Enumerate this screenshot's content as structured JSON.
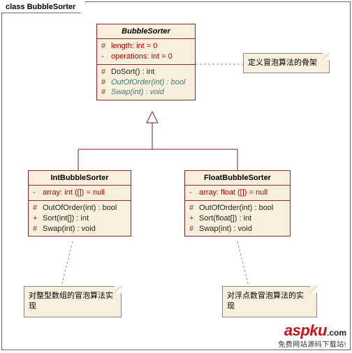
{
  "frame": {
    "title": "class BubbleSorter"
  },
  "classes": {
    "bubbleSorter": {
      "name": "BubbleSorter",
      "attrs": [
        {
          "vis": "#",
          "text": "length:  int = 0",
          "style": "red"
        },
        {
          "vis": "-",
          "text": "operations:  int = 0",
          "style": "red"
        }
      ],
      "ops": [
        {
          "vis": "#",
          "text": "DoSort() : int",
          "style": "nrm"
        },
        {
          "vis": "#",
          "text": "OutOfOrder(int) : bool",
          "style": "teal"
        },
        {
          "vis": "#",
          "text": "Swap(int) : void",
          "style": "teal"
        }
      ]
    },
    "intBubbleSorter": {
      "name": "IntBubbleSorter",
      "attrs": [
        {
          "vis": "-",
          "text": "array:  int ([]) = null",
          "style": "red"
        }
      ],
      "ops": [
        {
          "vis": "#",
          "text": "OutOfOrder(int) : bool",
          "style": "nrm"
        },
        {
          "vis": "+",
          "text": "Sort(int[]) : int",
          "style": "nrm"
        },
        {
          "vis": "#",
          "text": "Swap(int) : void",
          "style": "nrm"
        }
      ]
    },
    "floatBubbleSorter": {
      "name": "FloatBubbleSorter",
      "attrs": [
        {
          "vis": "-",
          "text": "array:  float ([]) = null",
          "style": "red"
        }
      ],
      "ops": [
        {
          "vis": "#",
          "text": "OutOfOrder(int) : bool",
          "style": "nrm"
        },
        {
          "vis": "+",
          "text": "Sort(float[]) : int",
          "style": "nrm"
        },
        {
          "vis": "#",
          "text": "Swap(int) : void",
          "style": "nrm"
        }
      ]
    }
  },
  "notes": {
    "n1": "定义冒泡算法的骨架",
    "n2": "对整型数组的冒泡算法实现",
    "n3": "对浮点数冒泡算法的实现"
  },
  "watermark": {
    "brand": "aspku",
    "suffix": ".com",
    "tagline": "免费网站源码下载站!"
  }
}
